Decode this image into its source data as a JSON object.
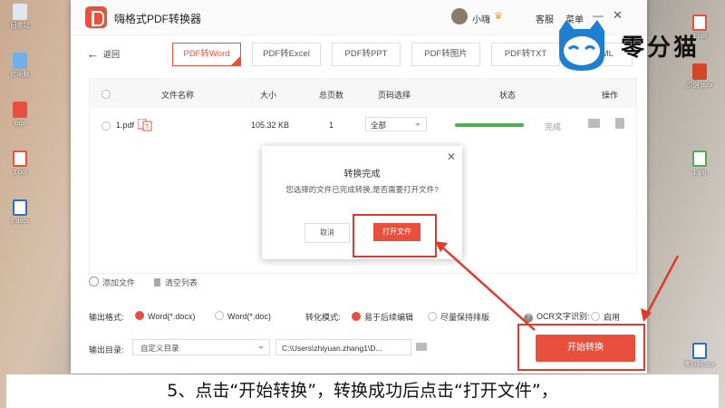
{
  "desktop": {
    "left_icons": [
      {
        "label": "回收站",
        "color": "#dfe6ee"
      },
      {
        "label": "此电脑",
        "color": "#6fb0e8"
      },
      {
        "label": "logo",
        "color": "#e8503d"
      },
      {
        "label": "1.pdf",
        "color": "#e8503d"
      },
      {
        "label": "1.docx",
        "color": "#2b6fc4"
      }
    ],
    "right_icons": [
      {
        "label": "1.pdf",
        "color": "#e8503d"
      },
      {
        "label": "示例.pptx",
        "color": "#d24726"
      },
      {
        "label": "1.jpg",
        "color": "#4caf50"
      },
      {
        "label": "零分猫.doc",
        "color": "#2b6fc4"
      }
    ]
  },
  "app": {
    "title": "嗨格式PDF转换器",
    "user": "小嗨",
    "crown": "♛",
    "customer_service": "客服",
    "menu": "菜单",
    "minimize": "—",
    "close": "✕",
    "back": "返回",
    "back_arrow": "←",
    "tabs": [
      {
        "label": "PDF转Word",
        "active": true
      },
      {
        "label": "PDF转Excel",
        "active": false
      },
      {
        "label": "PDF转PPT",
        "active": false
      },
      {
        "label": "PDF转图片",
        "active": false
      },
      {
        "label": "PDF转TXT",
        "active": false
      },
      {
        "label": "HTML",
        "active": false
      }
    ],
    "table": {
      "headers": [
        "文件名称",
        "大小",
        "总页数",
        "页码选择",
        "状态",
        "操作"
      ],
      "rows": [
        {
          "name": "1.pdf",
          "size": "105.32 KB",
          "pages": "1",
          "page_select": "全部",
          "progress": 1.0,
          "status": "完成"
        }
      ]
    },
    "add_file": "添加文件",
    "clear_list": "清空列表",
    "output_format_label": "输出格式:",
    "format_options": [
      {
        "label": "Word(*.docx)",
        "selected": true
      },
      {
        "label": "Word(*.doc)",
        "selected": false
      }
    ],
    "mode_label": "转化模式:",
    "mode_options": [
      {
        "label": "易于后续编辑",
        "selected": true
      },
      {
        "label": "尽量保持排版",
        "selected": false
      }
    ],
    "ocr_label": "OCR文字识别:",
    "ocr_option": "启用",
    "output_dir_label": "输出目录:",
    "output_dir_select": "自定义目录",
    "output_path": "C:\\Users\\zhiyuan.zhang1\\D...",
    "start_button": "开始转换",
    "accent_color": "#e8503d"
  },
  "dialog": {
    "title": "转换完成",
    "message": "您选择的文件已完成转换,是否需要打开文件?",
    "cancel": "取消",
    "open": "打开文件",
    "close": "✕"
  },
  "brand": {
    "name": "零分猫"
  },
  "caption": "5、点击“开始转换”，转换成功后点击“打开文件”，"
}
